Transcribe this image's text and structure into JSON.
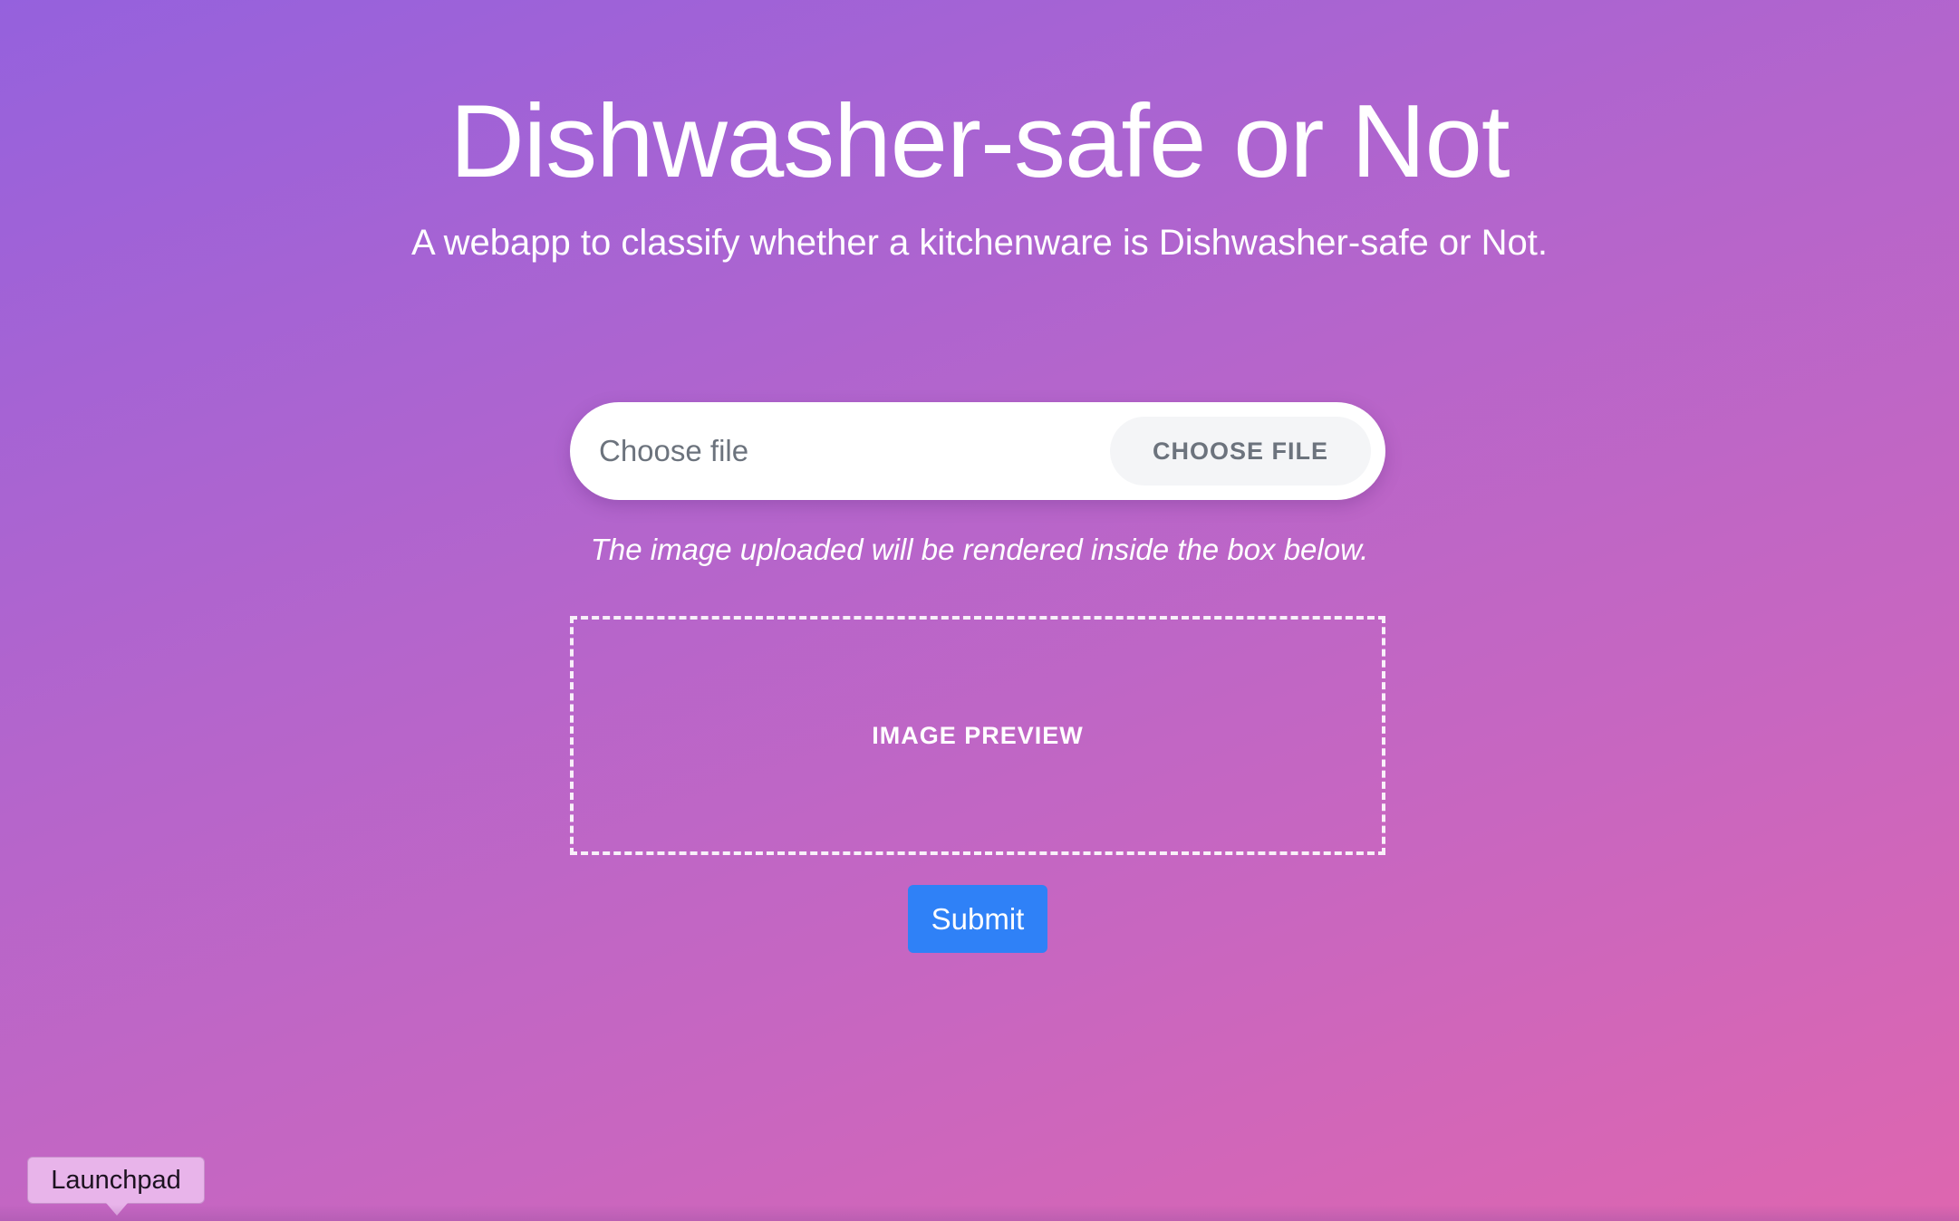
{
  "header": {
    "title": "Dishwasher-safe or Not",
    "subtitle": "A webapp to classify whether a kitchenware is Dishwasher-safe or Not."
  },
  "upload": {
    "placeholder": "Choose file",
    "button_label": "CHOOSE FILE",
    "note": "The image uploaded will be rendered inside the box below."
  },
  "preview": {
    "label": "IMAGE PREVIEW"
  },
  "actions": {
    "submit_label": "Submit"
  },
  "dock": {
    "tooltip_label": "Launchpad"
  },
  "colors": {
    "gradient_start": "#9561dd",
    "gradient_end": "#de66af",
    "submit_button": "#2f81f7",
    "tooltip_background": "#e8b4ea"
  }
}
